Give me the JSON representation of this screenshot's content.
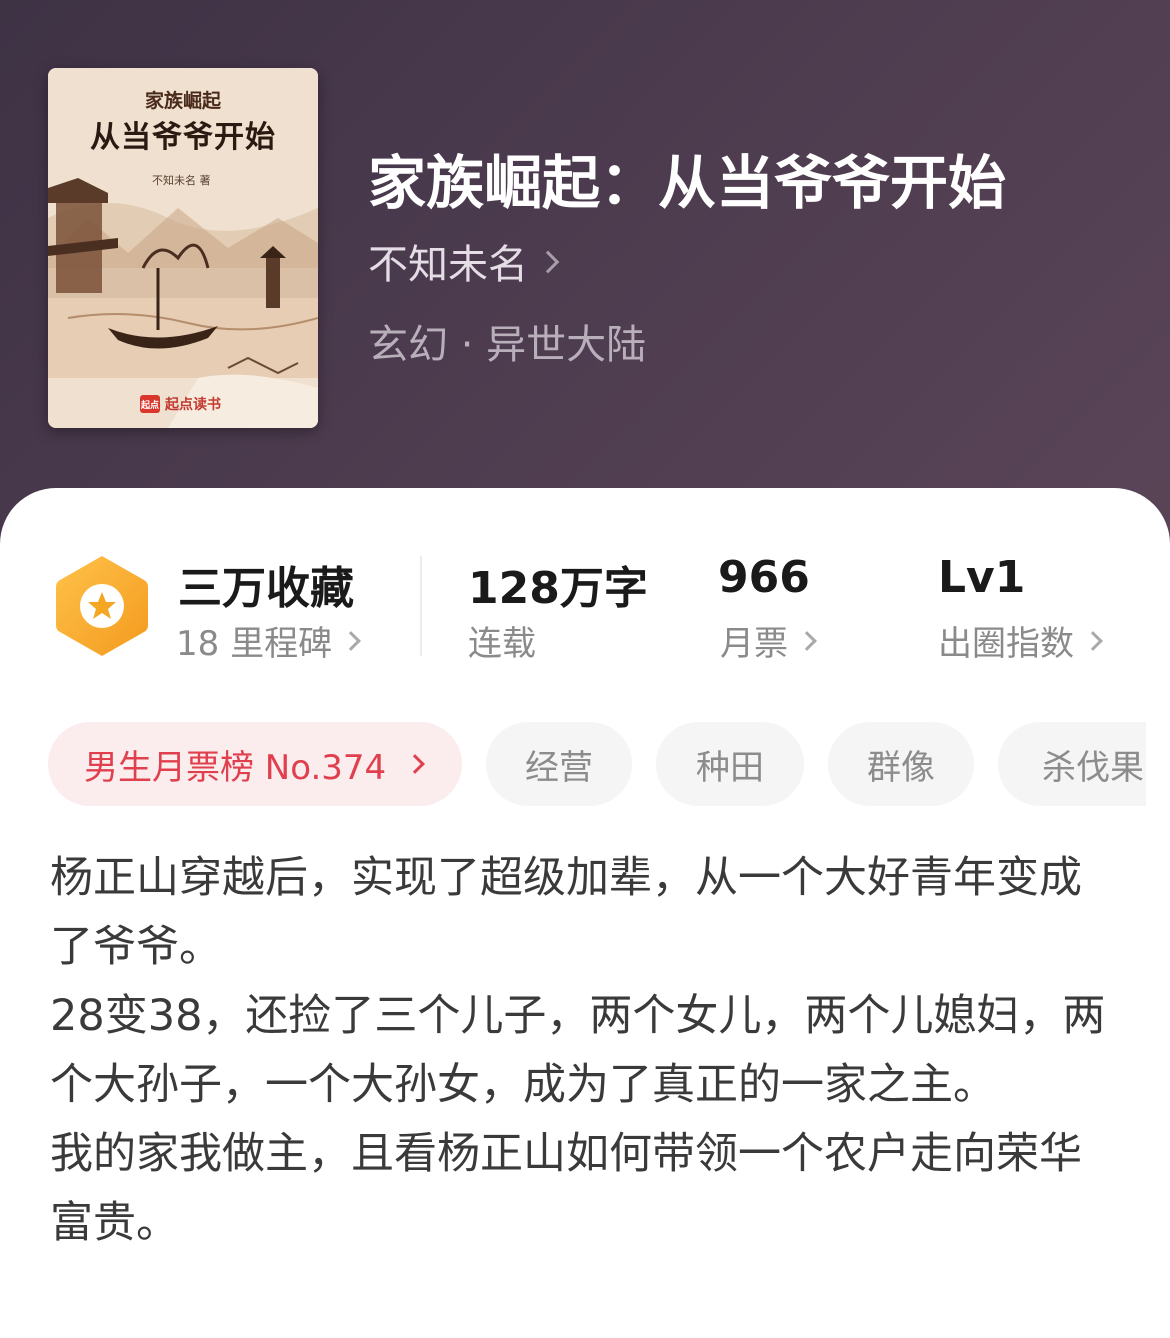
{
  "book": {
    "title": "家族崛起：从当爷爷开始",
    "author": "不知未名",
    "genre": "玄幻 · 异世大陆"
  },
  "cover": {
    "series_text": "家族崛起",
    "title_text": "从当爷爷开始",
    "author_text": "不知未名 著",
    "publisher_logo": "起点",
    "publisher": "起点读书"
  },
  "stats": {
    "collection": {
      "value": "三万收藏",
      "label": "18 里程碑"
    },
    "words": {
      "value": "128万字",
      "label": "连载"
    },
    "monthly_votes": {
      "value": "966",
      "label": "月票"
    },
    "popularity": {
      "value": "Lv1",
      "label": "出圈指数"
    }
  },
  "tags": {
    "rank": "男生月票榜 No.374",
    "items": [
      "经营",
      "种田",
      "群像",
      "杀伐果"
    ]
  },
  "description": [
    "杨正山穿越后，实现了超级加辈，从一个大好青年变成了爷爷。",
    "28变38，还捡了三个儿子，两个女儿，两个儿媳妇，两个大孙子，一个大孙女，成为了真正的一家之主。",
    "我的家我做主，且看杨正山如何带领一个农户走向荣华富贵。"
  ],
  "icons": {
    "badge": "star-badge-icon",
    "chevron": "chevron-right-icon"
  },
  "colors": {
    "header_bg": "#4b3b4d",
    "badge_orange": "#f5a623",
    "rank_red": "#e0404e",
    "rank_bg": "#fbecee"
  }
}
